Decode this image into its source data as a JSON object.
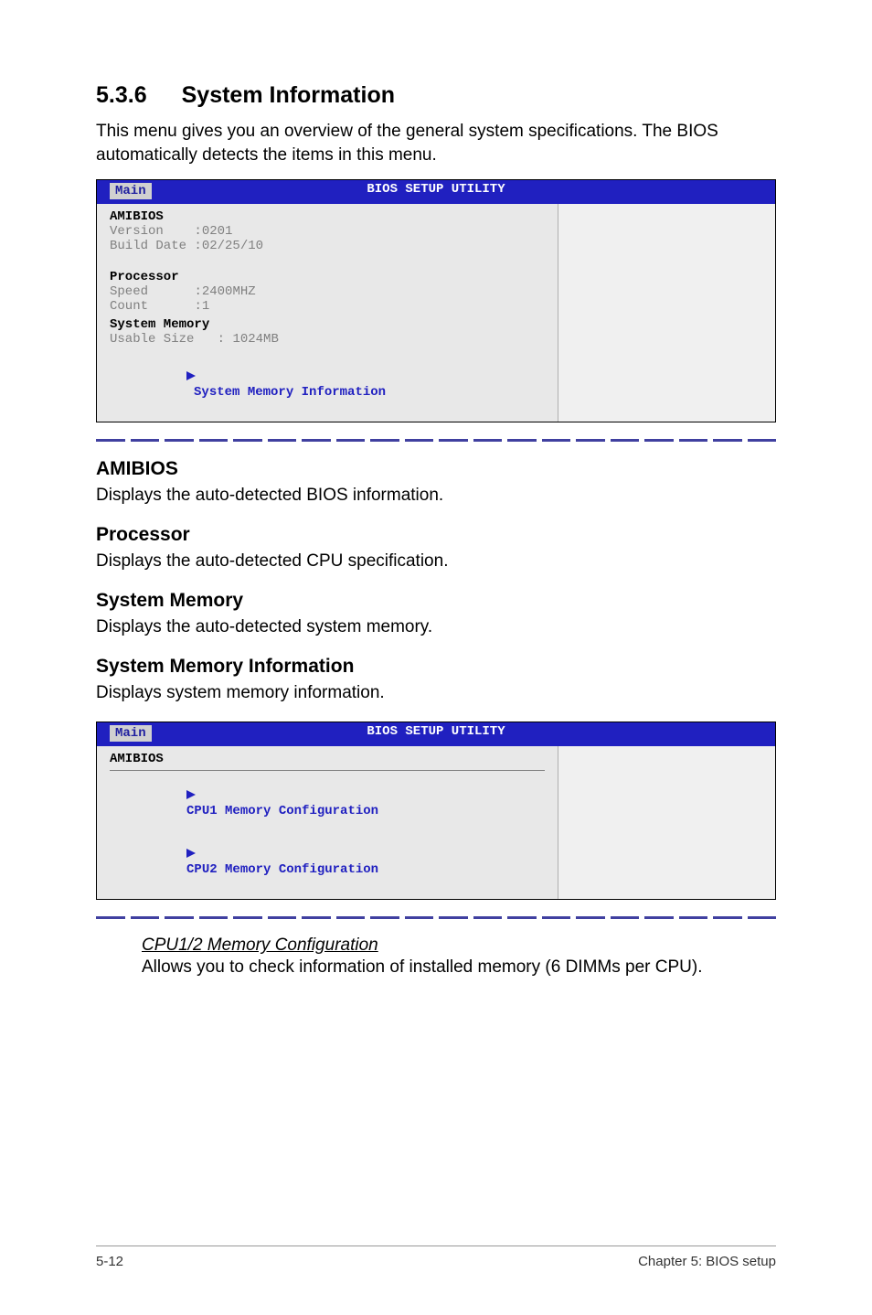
{
  "section": {
    "number": "5.3.6",
    "title": "System Information",
    "intro": "This menu gives you an overview of the general system specifications. The BIOS automatically detects the items in this menu."
  },
  "bios1": {
    "utility_title": "BIOS SETUP UTILITY",
    "tab": "Main",
    "amibios": {
      "label": "AMIBIOS",
      "version_label": "Version",
      "version_value": ":0201",
      "build_label": "Build Date",
      "build_value": ":02/25/10"
    },
    "processor": {
      "label": "Processor",
      "speed_label": "Speed",
      "speed_value": ":2400MHZ",
      "count_label": "Count",
      "count_value": ":1"
    },
    "memory": {
      "label": "System Memory",
      "usable_label": "Usable Size",
      "usable_value": ": 1024MB"
    },
    "link": "System Memory Information"
  },
  "descriptions": {
    "amibios": {
      "heading": "AMIBIOS",
      "text": "Displays the auto-detected BIOS information."
    },
    "processor": {
      "heading": "Processor",
      "text": "Displays the auto-detected CPU specification."
    },
    "sysmem": {
      "heading": "System Memory",
      "text": "Displays the auto-detected system memory."
    },
    "sysmeminfo": {
      "heading": "System Memory Information",
      "text": "Displays system memory information."
    }
  },
  "bios2": {
    "utility_title": "BIOS SETUP UTILITY",
    "tab": "Main",
    "amibios_label": "AMIBIOS",
    "cpu1": "CPU1 Memory Configuration",
    "cpu2": "CPU2 Memory Configuration"
  },
  "cpu_config": {
    "link": "CPU1/2 Memory Configuration",
    "desc": "Allows you to check information of installed memory (6 DIMMs per CPU)."
  },
  "footer": {
    "left": "5-12",
    "right": "Chapter 5: BIOS setup"
  }
}
